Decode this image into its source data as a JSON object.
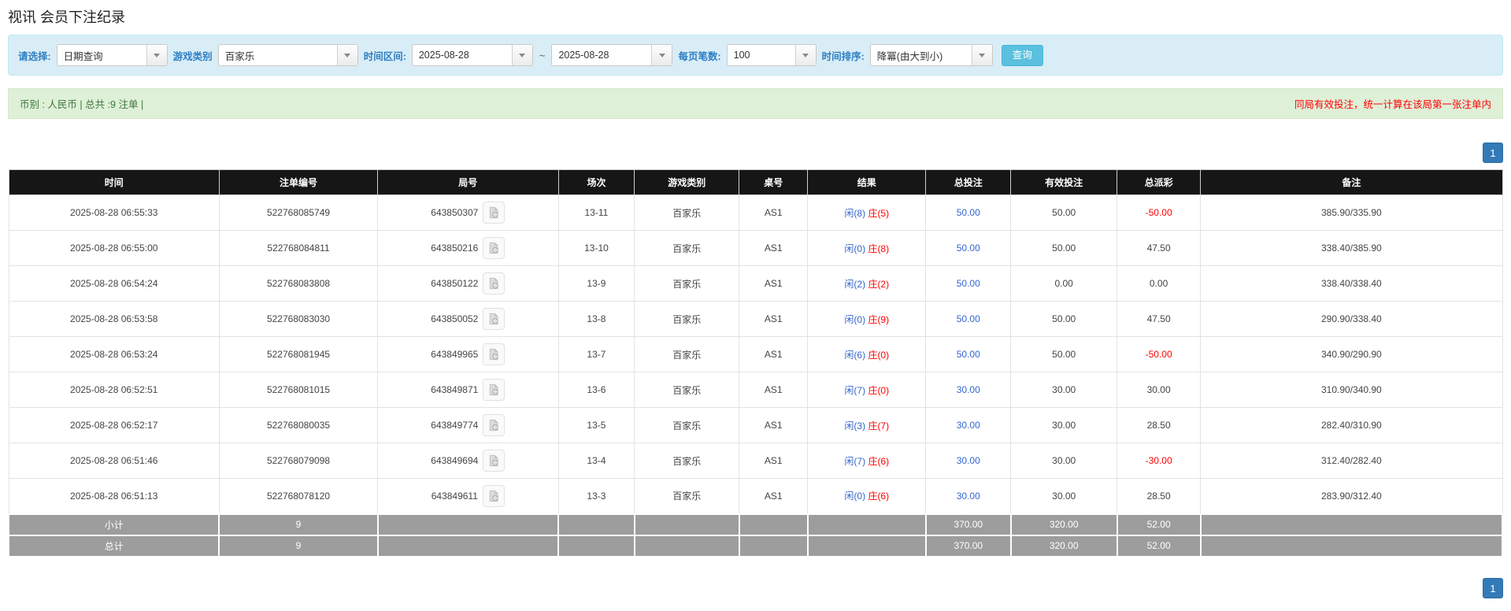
{
  "page": {
    "title": "视讯 会员下注纪录"
  },
  "filters": {
    "select_label": "请选择:",
    "select_value": "日期查询",
    "game_type_label": "游戏类别",
    "game_type_value": "百家乐",
    "date_range_label": "时间区间:",
    "date_from": "2025-08-28",
    "date_separator": "~",
    "date_to": "2025-08-28",
    "page_size_label": "每页笔数:",
    "page_size_value": "100",
    "sort_label": "时间排序:",
    "sort_value": "降冪(由大到小)",
    "search_button": "查询"
  },
  "summary": {
    "left_text": "币别 : 人民币 | 总共 :9 注单 |",
    "right_note": "同局有效投注，统一计算在该局第一张注单内"
  },
  "pagination": {
    "page": "1"
  },
  "table": {
    "headers": [
      "时间",
      "注单编号",
      "局号",
      "场次",
      "游戏类别",
      "桌号",
      "结果",
      "总投注",
      "有效投注",
      "总派彩",
      "备注"
    ],
    "rows": [
      {
        "time": "2025-08-28 06:55:33",
        "bet_no": "522768085749",
        "round_no": "643850307",
        "session": "13-11",
        "game": "百家乐",
        "table_no": "AS1",
        "result_player": "闲(8)",
        "result_banker": "庄(5)",
        "total_bet": "50.00",
        "valid_bet": "50.00",
        "payout": "-50.00",
        "note": "385.90/335.90"
      },
      {
        "time": "2025-08-28 06:55:00",
        "bet_no": "522768084811",
        "round_no": "643850216",
        "session": "13-10",
        "game": "百家乐",
        "table_no": "AS1",
        "result_player": "闲(0)",
        "result_banker": "庄(8)",
        "total_bet": "50.00",
        "valid_bet": "50.00",
        "payout": "47.50",
        "note": "338.40/385.90"
      },
      {
        "time": "2025-08-28 06:54:24",
        "bet_no": "522768083808",
        "round_no": "643850122",
        "session": "13-9",
        "game": "百家乐",
        "table_no": "AS1",
        "result_player": "闲(2)",
        "result_banker": "庄(2)",
        "total_bet": "50.00",
        "valid_bet": "0.00",
        "payout": "0.00",
        "note": "338.40/338.40"
      },
      {
        "time": "2025-08-28 06:53:58",
        "bet_no": "522768083030",
        "round_no": "643850052",
        "session": "13-8",
        "game": "百家乐",
        "table_no": "AS1",
        "result_player": "闲(0)",
        "result_banker": "庄(9)",
        "total_bet": "50.00",
        "valid_bet": "50.00",
        "payout": "47.50",
        "note": "290.90/338.40"
      },
      {
        "time": "2025-08-28 06:53:24",
        "bet_no": "522768081945",
        "round_no": "643849965",
        "session": "13-7",
        "game": "百家乐",
        "table_no": "AS1",
        "result_player": "闲(6)",
        "result_banker": "庄(0)",
        "total_bet": "50.00",
        "valid_bet": "50.00",
        "payout": "-50.00",
        "note": "340.90/290.90"
      },
      {
        "time": "2025-08-28 06:52:51",
        "bet_no": "522768081015",
        "round_no": "643849871",
        "session": "13-6",
        "game": "百家乐",
        "table_no": "AS1",
        "result_player": "闲(7)",
        "result_banker": "庄(0)",
        "total_bet": "30.00",
        "valid_bet": "30.00",
        "payout": "30.00",
        "note": "310.90/340.90"
      },
      {
        "time": "2025-08-28 06:52:17",
        "bet_no": "522768080035",
        "round_no": "643849774",
        "session": "13-5",
        "game": "百家乐",
        "table_no": "AS1",
        "result_player": "闲(3)",
        "result_banker": "庄(7)",
        "total_bet": "30.00",
        "valid_bet": "30.00",
        "payout": "28.50",
        "note": "282.40/310.90"
      },
      {
        "time": "2025-08-28 06:51:46",
        "bet_no": "522768079098",
        "round_no": "643849694",
        "session": "13-4",
        "game": "百家乐",
        "table_no": "AS1",
        "result_player": "闲(7)",
        "result_banker": "庄(6)",
        "total_bet": "30.00",
        "valid_bet": "30.00",
        "payout": "-30.00",
        "note": "312.40/282.40"
      },
      {
        "time": "2025-08-28 06:51:13",
        "bet_no": "522768078120",
        "round_no": "643849611",
        "session": "13-3",
        "game": "百家乐",
        "table_no": "AS1",
        "result_player": "闲(0)",
        "result_banker": "庄(6)",
        "total_bet": "30.00",
        "valid_bet": "30.00",
        "payout": "28.50",
        "note": "283.90/312.40"
      }
    ],
    "subtotal": {
      "label": "小计",
      "count": "9",
      "total_bet": "370.00",
      "valid_bet": "320.00",
      "payout": "52.00"
    },
    "total": {
      "label": "总计",
      "count": "9",
      "total_bet": "370.00",
      "valid_bet": "320.00",
      "payout": "52.00"
    }
  },
  "icons": {
    "video_replay": "video-replay-icon",
    "dropdown": "chevron-down-icon"
  },
  "colors": {
    "accent": "#337ab7",
    "header_bg": "#161616",
    "footer_bg": "#9d9d9d",
    "filter_bg": "#d9edf7",
    "filter_border": "#bce8f1",
    "label_blue": "#2e7fc2",
    "button_bg": "#5bc0de",
    "summary_bg": "#dff0d8",
    "summary_text": "#3c763d",
    "note_red": "#ff0000",
    "player_blue": "#3366cc",
    "banker_red": "#ff0000",
    "link_blue": "#3366cc",
    "negative_red": "#ff0000"
  }
}
